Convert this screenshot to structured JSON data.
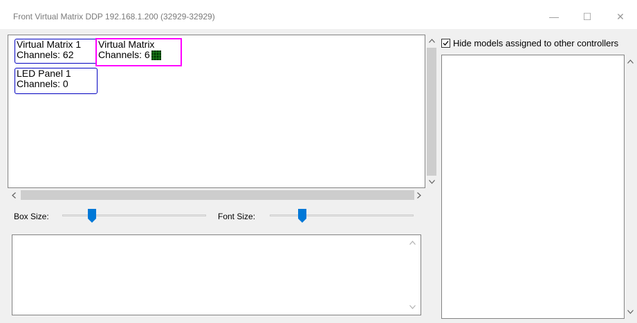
{
  "window": {
    "title": "Front Virtual Matrix DDP 192.168.1.200 (32929-32929)",
    "minimize_glyph": "—",
    "maximize_glyph": "☐",
    "close_glyph": "✕"
  },
  "canvas": {
    "boxes": [
      {
        "name": "Virtual Matrix 1",
        "channels_label": "Channels: 62"
      },
      {
        "name": "Virtual Matrix",
        "channels_label": "Channels: 6"
      },
      {
        "name": "LED Panel 1",
        "channels_label": "Channels: 0"
      }
    ]
  },
  "controls": {
    "box_size_label": "Box Size:",
    "font_size_label": "Font Size:",
    "box_size_value": 0.19,
    "font_size_value": 0.21
  },
  "right_panel": {
    "checkbox_label": "Hide models assigned to other controllers",
    "checkbox_checked": true
  },
  "colors": {
    "box_border": "#0000c0",
    "selected_border": "#ff00ff",
    "slider_thumb": "#0078d7"
  }
}
